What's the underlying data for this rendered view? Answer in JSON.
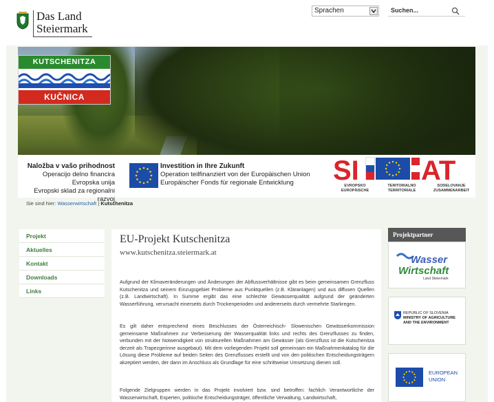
{
  "header": {
    "logo_line1": "Das Land",
    "logo_line2": "Steiermark",
    "language_select": "Sprachen",
    "search_placeholder": "Suchen..."
  },
  "hero": {
    "project_logo_top": "KUTSCHENITZA",
    "project_logo_bottom": "KUČNICA"
  },
  "funding": {
    "si_head": "Naložba v vašo prihodnost",
    "si_line1": "Operacijo delno financira Evropska unija",
    "si_line2": "Evropski sklad za regionalni razvoj",
    "at_head": "Investition in Ihre Zukunft",
    "at_line1": "Operation teilfinanziert von der Europäischen Union",
    "at_line2": "Europäischer Fonds für regionale Entwicklung",
    "siat_letters": "SI  AT",
    "siat_cap1a": "EVROPSKO",
    "siat_cap1b": "EUROPÄISCHE",
    "siat_cap2a": "TERITORIALNO",
    "siat_cap2b": "TERRITORIALE",
    "siat_cap3a": "SODELOVANJE",
    "siat_cap3b": "ZUSAMMENARBEIT"
  },
  "breadcrumb": {
    "prefix": "Sie sind hier: ",
    "link": "Wasserwirtschaft",
    "sep": " | ",
    "current": "Kutschenitza"
  },
  "nav": [
    {
      "label": "Projekt"
    },
    {
      "label": "Aktuelles"
    },
    {
      "label": "Kontakt"
    },
    {
      "label": "Downloads"
    },
    {
      "label": "Links"
    }
  ],
  "main": {
    "title": "EU-Projekt Kutschenitza",
    "url": "www.kutschenitza.steiermark.at",
    "p1": "Aufgrund der Klimaveränderungen und Änderungen der Abflussverhältnisse gibt es beim gemeinsamen Grenzfluss Kutschenitza und seinem Einzugsgebiet Probleme aus Punktquellen (z.B. Kläranlagen) und aus diffusen Quellen (z.B. Landwirtschaft). In Summe ergibt das eine schlechte Gewässerqualität aufgrund der geänderten Wasserführung, verursacht einerseits durch Trockenperioden und andererseits durch vermehrte Starkregen.",
    "p2": "Es gilt daher entsprechend eines Beschlusses der Österreichisch- Slowenischen Gewässerkommission gemeinsame Maßnahmen zur Verbesserung der Wasserqualität links und rechts des Grenzflusses zu finden, verbunden mit der Notwendigkeit von strukturellen Maßnahmen am Gewässer (als Grenzfluss ist die Kutschenitza derzeit als Trapezgerinne ausgebaut). Mit dem vorliegenden Projekt soll gemeinsam ein Maßnahmenkatalog für die Lösung diese Probleme auf beiden Seiten des Grenzflusses erstellt und von den politischen Entscheidungsträgern akzeptiert werden, der dann im Anschluss als Grundlage für eine schrittweise Umsetzung dienen soll.",
    "p3": "Folgende Zielgruppen werden in das Projekt involviert bzw. sind betroffen: fachlich Verantwortliche der Wasserwirtschaft, Experten, politische Entscheidungsträger, öffentliche Verwaltung, Landwirtschaft,"
  },
  "partners": {
    "heading": "Projektpartner",
    "p1_line1": "Wasser",
    "p1_line2": "Wirtschaft",
    "p1_line3": "Land Steiermark",
    "p2_top": "REPUBLIC OF SLOVENIA",
    "p2_line1": "MINISTRY OF AGRICULTURE",
    "p2_line2": "AND THE ENVIRONMENT",
    "p3_line1": "EUROPEAN",
    "p3_line2": "UNION"
  }
}
